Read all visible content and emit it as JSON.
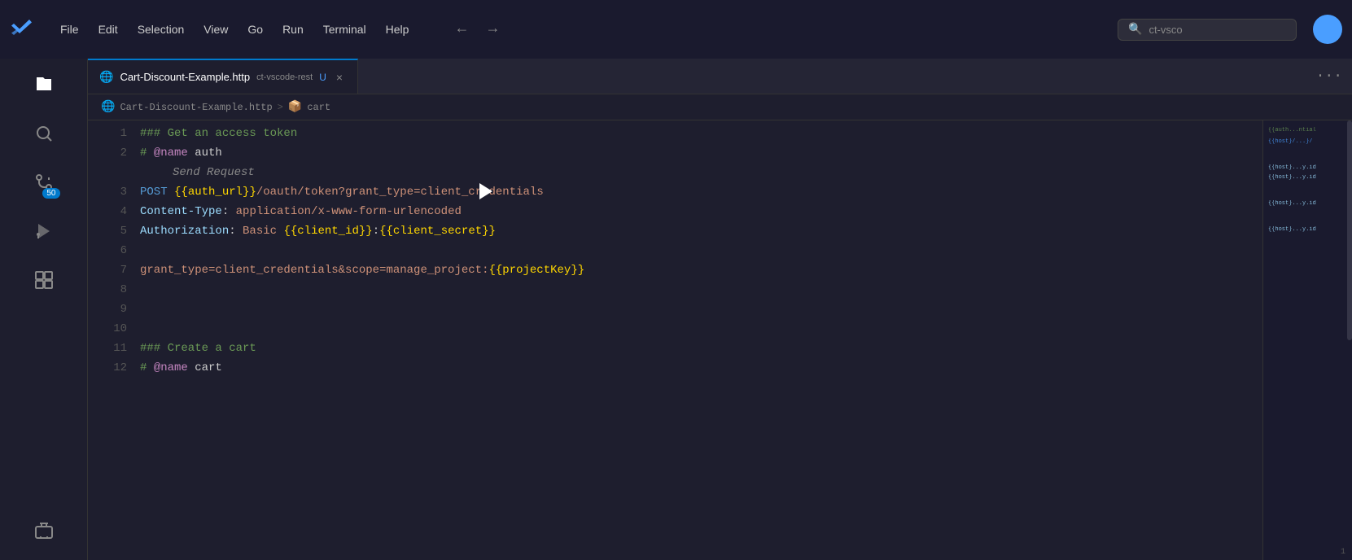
{
  "titlebar": {
    "menu_items": [
      "File",
      "Edit",
      "Selection",
      "View",
      "Go",
      "Run",
      "Terminal",
      "Help"
    ],
    "nav_back": "←",
    "nav_forward": "→",
    "search_placeholder": "ct-vsco",
    "search_icon": "🔍"
  },
  "tab": {
    "icon": "🌐",
    "label": "Cart-Discount-Example.http",
    "subtitle": "ct-vscode-rest",
    "unsaved": "U",
    "close": "×",
    "more": "···"
  },
  "breadcrumb": {
    "file_icon": "🌐",
    "file": "Cart-Discount-Example.http",
    "sep": ">",
    "section_icon": "📦",
    "section": "cart"
  },
  "activity": {
    "icons": [
      "⧉",
      "🔍",
      "⎇",
      "▶",
      "⊞",
      "🖥"
    ]
  },
  "badge": {
    "count": "50"
  },
  "lines": [
    {
      "num": "1",
      "content": "### Get an access token",
      "type": "comment"
    },
    {
      "num": "2",
      "content": "# @name auth",
      "type": "name"
    },
    {
      "num": "3",
      "content": "Send Request",
      "type": "send"
    },
    {
      "num": "3",
      "content": "POST {{auth_url}}/oauth/token?grant_type=client_credentials",
      "type": "method"
    },
    {
      "num": "4",
      "content": "Content-Type: application/x-www-form-urlencoded",
      "type": "header"
    },
    {
      "num": "5",
      "content": "Authorization: Basic {{client_id}}:{{client_secret}}",
      "type": "header"
    },
    {
      "num": "6",
      "content": "",
      "type": "empty"
    },
    {
      "num": "7",
      "content": "grant_type=client_credentials&scope=manage_project:{{projectKey}}",
      "type": "body"
    },
    {
      "num": "8",
      "content": "",
      "type": "empty"
    },
    {
      "num": "9",
      "content": "",
      "type": "empty"
    },
    {
      "num": "10",
      "content": "",
      "type": "empty"
    },
    {
      "num": "11",
      "content": "### Create a cart",
      "type": "comment"
    },
    {
      "num": "12",
      "content": "# @name cart",
      "type": "name"
    }
  ],
  "minimap": {
    "lines": [
      "comment",
      "keyword",
      "empty",
      "url",
      "header",
      "header",
      "empty",
      "body",
      "empty",
      "empty",
      "empty",
      "comment",
      "name"
    ]
  }
}
